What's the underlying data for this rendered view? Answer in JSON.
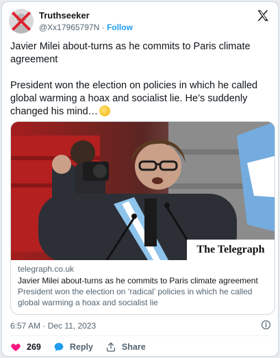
{
  "author": {
    "name": "Truthseeker",
    "handle": "@Xx17965797N",
    "separator": "·",
    "follow_label": "Follow"
  },
  "post": {
    "paragraph1": "Javier Milei about-turns as he commits to Paris climate agreement",
    "paragraph2": "President won the election on policies in which he called global warming a hoax and socialist lie. He’s suddenly changed his mind…",
    "emoji": "thinking-face"
  },
  "link_card": {
    "image_overlay": "The Telegraph",
    "domain": "telegraph.co.uk",
    "headline": "Javier Milei about-turns as he commits to Paris climate agreement",
    "description": "President won the election on ‘radical’ policies in which he called global warming a hoax and socialist lie"
  },
  "meta": {
    "timestamp": "6:57 AM · Dec 11, 2023"
  },
  "actions": {
    "like_count": "269",
    "reply_label": "Reply",
    "share_label": "Share"
  },
  "colors": {
    "like": "#f91880",
    "reply": "#1d9bf0",
    "link": "#1d9bf0",
    "secondary_text": "#536471"
  },
  "icons": [
    "x-logo-icon",
    "info-icon",
    "heart-icon",
    "reply-bubble-icon",
    "share-icon",
    "thinking-face-emoji"
  ]
}
